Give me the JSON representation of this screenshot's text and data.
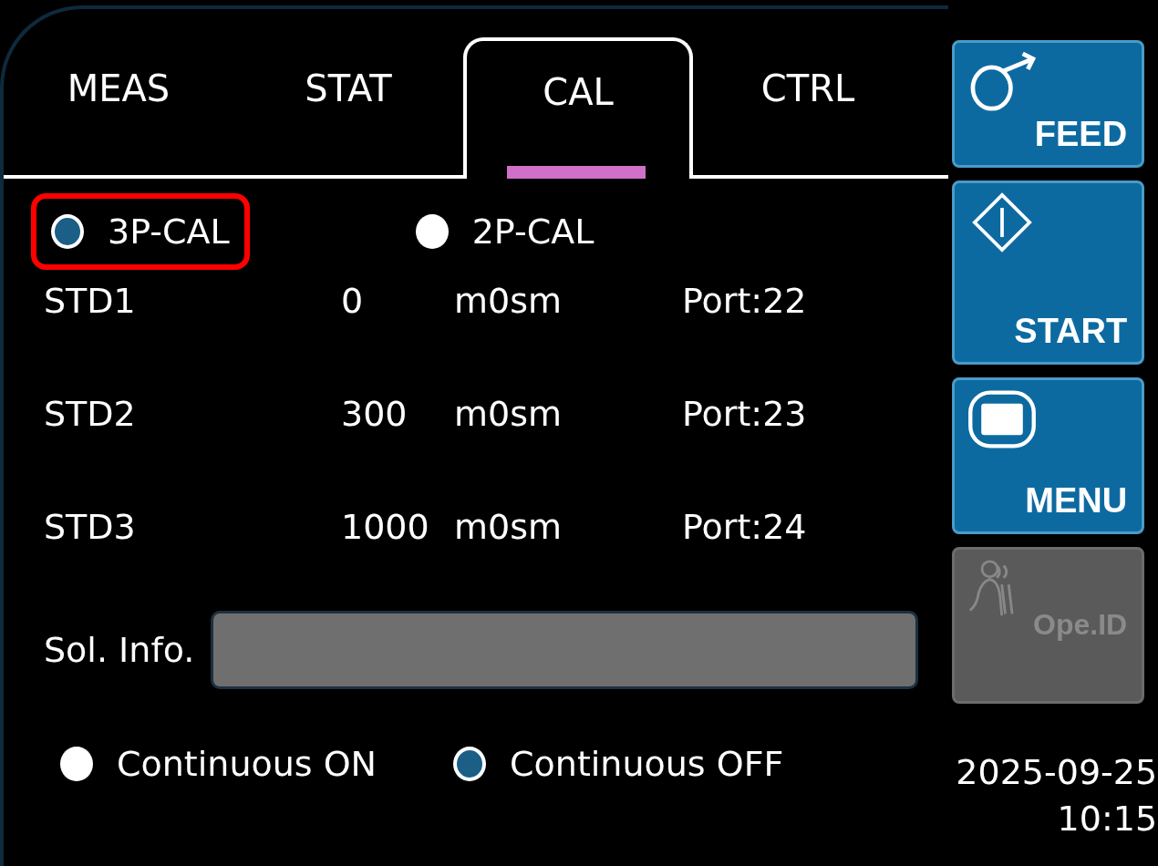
{
  "tabs": [
    {
      "label": "MEAS",
      "selected": false
    },
    {
      "label": "STAT",
      "selected": false
    },
    {
      "label": "CAL",
      "selected": true
    },
    {
      "label": "CTRL",
      "selected": false
    }
  ],
  "cal_mode": [
    {
      "label": "3P-CAL",
      "selected": true,
      "highlighted": true
    },
    {
      "label": "2P-CAL",
      "selected": false,
      "highlighted": false
    }
  ],
  "standards": [
    {
      "name": "STD1",
      "value": "0",
      "unit": "m0sm",
      "port": "Port:22"
    },
    {
      "name": "STD2",
      "value": "300",
      "unit": "m0sm",
      "port": "Port:23"
    },
    {
      "name": "STD3",
      "value": "1000",
      "unit": "m0sm",
      "port": "Port:24"
    }
  ],
  "sol_info": {
    "label": "Sol. Info."
  },
  "continuous": [
    {
      "label": "Continuous ON",
      "selected": false
    },
    {
      "label": "Continuous OFF",
      "selected": true
    }
  ],
  "side_buttons": [
    {
      "kind": "feed",
      "label": "FEED",
      "disabled": false
    },
    {
      "kind": "start",
      "label": "START",
      "disabled": false
    },
    {
      "kind": "menu",
      "label": "MENU",
      "disabled": false
    },
    {
      "kind": "operator",
      "label": "Ope.ID",
      "disabled": true
    }
  ],
  "date": "2025-09-25",
  "time": "10:15"
}
